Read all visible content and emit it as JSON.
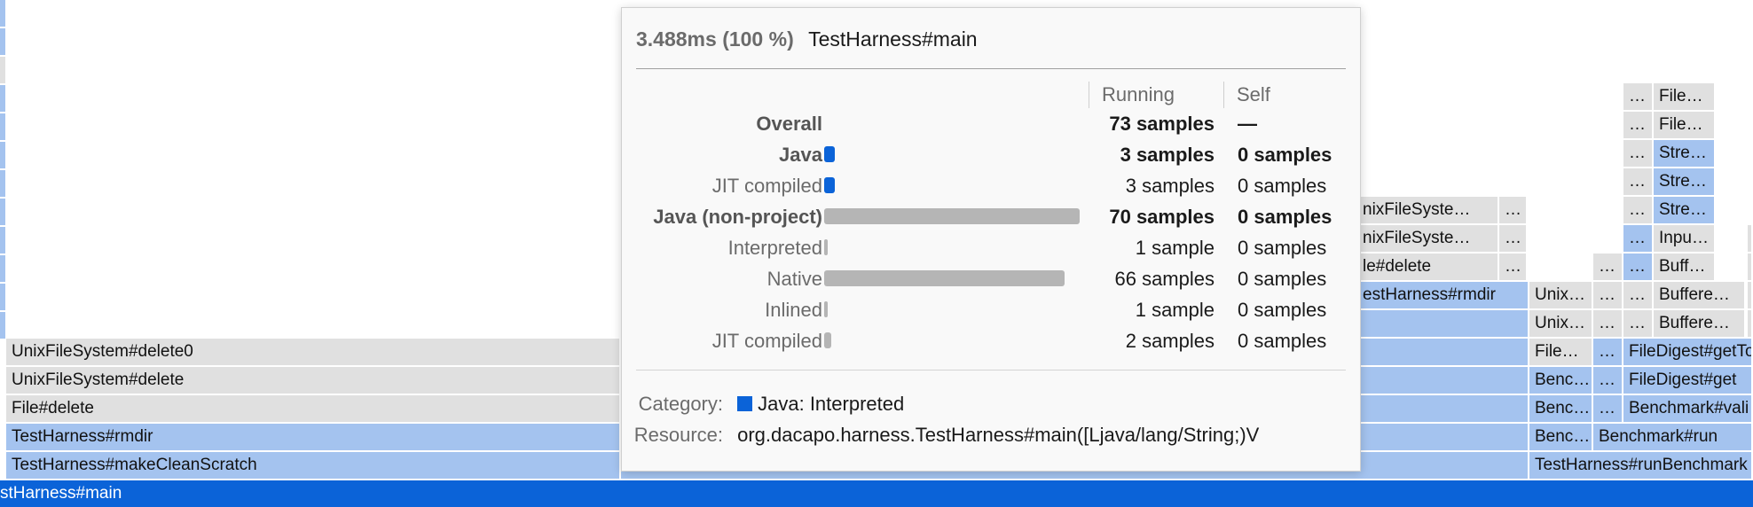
{
  "colors": {
    "frame_blue": "#a4c3ef",
    "frame_gray": "#e0e0e0",
    "frame_selected": "#0b63d8",
    "bar_blue": "#0b63d8",
    "bar_gray": "#b5b5b5"
  },
  "flame": {
    "root_label": "stHarness#main",
    "left_rows": [
      "UnixFileSystem#delete0",
      "UnixFileSystem#delete",
      "File#delete",
      "TestHarness#rmdir",
      "TestHarness#makeCleanScratch"
    ],
    "mid": {
      "r1": "nixFileSyste…",
      "r1_more": "…",
      "r2": "nixFileSyste…",
      "r2_more": "…",
      "r3": "le#delete",
      "r3_more": "…",
      "r4": "estHarness#rmdir"
    },
    "right": {
      "c1": [
        "Unix…",
        "Unix…",
        "File…",
        "Benc…",
        "Benc…",
        "Benc…",
        "TestHarness#runBenchmark"
      ],
      "ell": "…",
      "c4": [
        "File…",
        "File…",
        "Stre…",
        "Stre…",
        "Stre…",
        "Inpu…",
        "Buff…",
        "Buffere…",
        "Buffere…",
        "FileDigest#getTo",
        "FileDigest#get",
        "Benchmark#vali",
        "Benchmark#run"
      ]
    }
  },
  "tooltip": {
    "duration": "3.488ms (100 %)",
    "name": "TestHarness#main",
    "col_running": "Running",
    "col_self": "Self",
    "rows": [
      {
        "label": "Overall",
        "running": "73 samples",
        "self": "—"
      },
      {
        "label": "Java",
        "running": "3 samples",
        "self": "0 samples"
      },
      {
        "label": "JIT compiled",
        "running": "3 samples",
        "self": "0 samples"
      },
      {
        "label": "Java (non-project)",
        "running": "70 samples",
        "self": "0 samples"
      },
      {
        "label": "Interpreted",
        "running": "1 sample",
        "self": "0 samples"
      },
      {
        "label": "Native",
        "running": "66 samples",
        "self": "0 samples"
      },
      {
        "label": "Inlined",
        "running": "1 sample",
        "self": "0 samples"
      },
      {
        "label": "JIT compiled",
        "running": "2 samples",
        "self": "0 samples"
      }
    ],
    "bar_fractions": {
      "java": 0.041,
      "jit1": 0.041,
      "nonproject": 0.959,
      "interpreted": 0.014,
      "native": 0.904,
      "inlined": 0.014,
      "jit2": 0.027
    },
    "category_key": "Category:",
    "category_value": "Java: Interpreted",
    "resource_key": "Resource:",
    "resource_value": "org.dacapo.harness.TestHarness#main([Ljava/lang/String;)V"
  }
}
